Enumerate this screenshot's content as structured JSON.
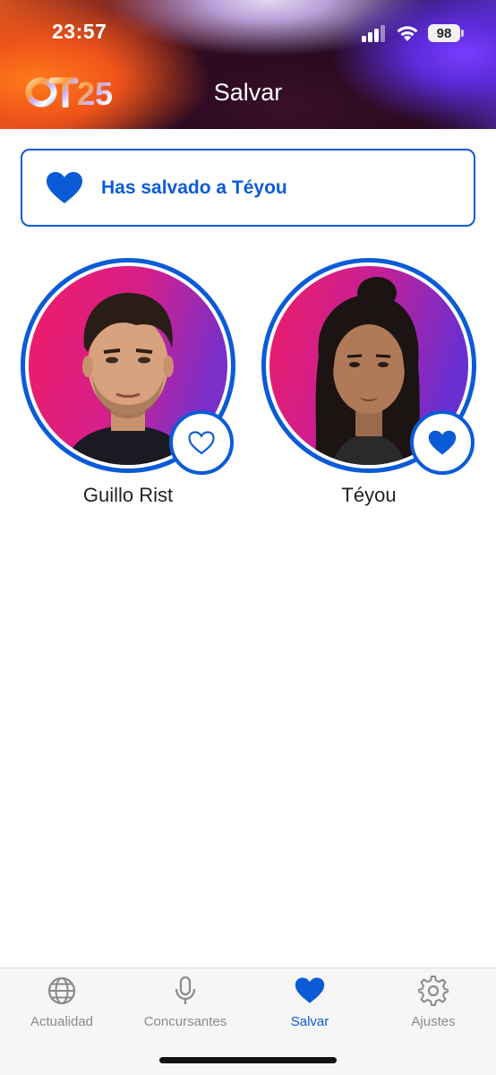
{
  "status_bar": {
    "time": "23:57",
    "battery": "98",
    "icons": [
      "signal-icon",
      "wifi-icon",
      "battery-icon"
    ]
  },
  "header": {
    "logo_text": "OT25",
    "title": "Salvar"
  },
  "banner": {
    "icon": "heart-filled-icon",
    "message": "Has salvado a Téyou"
  },
  "contestants": [
    {
      "name": "Guillo Rist",
      "saved": false,
      "fav_icon": "heart-outline-icon"
    },
    {
      "name": "Téyou",
      "saved": true,
      "fav_icon": "heart-filled-icon"
    }
  ],
  "tabbar": {
    "items": [
      {
        "label": "Actualidad",
        "icon": "globe-icon",
        "active": false
      },
      {
        "label": "Concursantes",
        "icon": "microphone-icon",
        "active": false
      },
      {
        "label": "Salvar",
        "icon": "heart-icon",
        "active": true
      },
      {
        "label": "Ajustes",
        "icon": "gear-icon",
        "active": false
      }
    ]
  },
  "colors": {
    "accent": "#0b5bd7",
    "inactive_tab": "#8a8a8e",
    "tabbar_bg": "#f6f6f6"
  }
}
